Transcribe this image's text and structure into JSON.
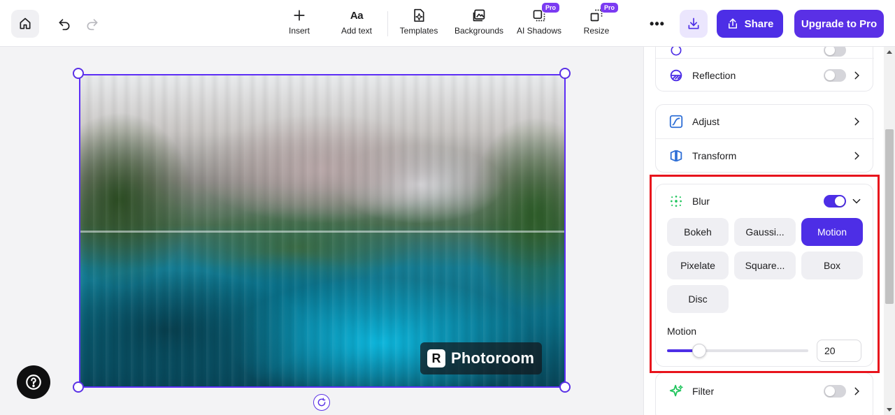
{
  "toolbar": {
    "tools": [
      {
        "label": "Insert",
        "icon": "plus-icon"
      },
      {
        "label": "Add text",
        "icon": "text-icon",
        "glyph": "Aa"
      },
      {
        "label": "Templates",
        "icon": "templates-icon"
      },
      {
        "label": "Backgrounds",
        "icon": "backgrounds-icon"
      },
      {
        "label": "AI Shadows",
        "icon": "ai-shadows-icon",
        "badge": "Pro"
      },
      {
        "label": "Resize",
        "icon": "resize-icon",
        "badge": "Pro"
      }
    ],
    "more_glyph": "•••",
    "share_label": "Share",
    "upgrade_label": "Upgrade to Pro"
  },
  "canvas": {
    "watermark_text": "Photoroom"
  },
  "panel": {
    "reflection": {
      "label": "Reflection",
      "enabled": false
    },
    "adjust": {
      "label": "Adjust"
    },
    "transform": {
      "label": "Transform"
    },
    "blur": {
      "label": "Blur",
      "enabled": true,
      "options": [
        "Bokeh",
        "Gaussi...",
        "Motion",
        "Pixelate",
        "Square...",
        "Box",
        "Disc"
      ],
      "selected": "Motion",
      "slider_label": "Motion",
      "value": "20",
      "slider_fraction": 0.2
    },
    "filter": {
      "label": "Filter",
      "enabled": false
    }
  },
  "colors": {
    "accent": "#4d2ee6",
    "upgrade": "#5a30e6",
    "pro_badge": "#7b3bf2",
    "highlight": "#e8141c",
    "filter_icon": "#22c55e"
  }
}
